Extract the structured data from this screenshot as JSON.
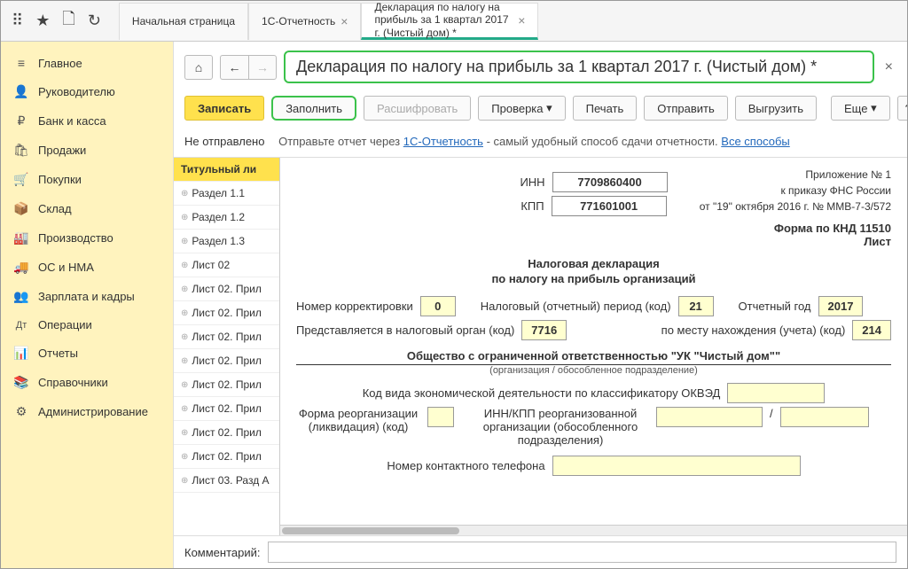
{
  "top_tabs": {
    "t1": "Начальная страница",
    "t2": "1С-Отчетность",
    "t3": "Декларация по налогу на прибыль за 1 квартал 2017 г. (Чистый дом) *"
  },
  "sidebar": {
    "items": [
      {
        "icon": "≡",
        "label": "Главное"
      },
      {
        "icon": "👤",
        "label": "Руководителю"
      },
      {
        "icon": "₽",
        "label": "Банк и касса"
      },
      {
        "icon": "🛍",
        "label": "Продажи"
      },
      {
        "icon": "🛒",
        "label": "Покупки"
      },
      {
        "icon": "📦",
        "label": "Склад"
      },
      {
        "icon": "🏭",
        "label": "Производство"
      },
      {
        "icon": "🚚",
        "label": "ОС и НМА"
      },
      {
        "icon": "👥",
        "label": "Зарплата и кадры"
      },
      {
        "icon": "Дт",
        "label": "Операции"
      },
      {
        "icon": "📊",
        "label": "Отчеты"
      },
      {
        "icon": "📚",
        "label": "Справочники"
      },
      {
        "icon": "⚙",
        "label": "Администрирование"
      }
    ]
  },
  "page_title": "Декларация по налогу на прибыль за 1 квартал 2017 г. (Чистый дом) *",
  "toolbar": {
    "save": "Записать",
    "fill": "Заполнить",
    "decode": "Расшифровать",
    "check": "Проверка",
    "print": "Печать",
    "send": "Отправить",
    "export": "Выгрузить",
    "more": "Еще",
    "help": "?"
  },
  "status": {
    "label": "Не отправлено",
    "text1": "Отправьте отчет через ",
    "link1": "1С-Отчетность",
    "text2": " - самый удобный способ сдачи отчетности. ",
    "link2": "Все способы"
  },
  "tree": [
    "Титульный ли",
    "Раздел 1.1",
    "Раздел 1.2",
    "Раздел 1.3",
    "Лист 02",
    "Лист 02. Прил",
    "Лист 02. Прил",
    "Лист 02. Прил",
    "Лист 02. Прил",
    "Лист 02. Прил",
    "Лист 02. Прил",
    "Лист 02. Прил",
    "Лист 02. Прил",
    "Лист 03. Разд А"
  ],
  "form": {
    "app_line1": "Приложение № 1",
    "app_line2": "к приказу ФНС России",
    "app_line3": "от \"19\" октября 2016 г. № ММВ-7-3/572",
    "inn_label": "ИНН",
    "inn": "7709860400",
    "kpp_label": "КПП",
    "kpp": "771601001",
    "knd": "Форма по КНД 11510",
    "sheet": "Лист",
    "title1": "Налоговая декларация",
    "title2": "по налогу на прибыль организаций",
    "corr_label": "Номер корректировки",
    "corr": "0",
    "period_label": "Налоговый (отчетный) период (код)",
    "period": "21",
    "year_label": "Отчетный год",
    "year": "2017",
    "organ_label": "Представляется в налоговый орган (код)",
    "organ": "7716",
    "place_label": "по месту нахождения (учета) (код)",
    "place": "214",
    "org_name": "Общество с ограниченной ответственностью \"УК \"Чистый дом\"\"",
    "org_sub": "(организация / обособленное подразделение)",
    "okved_label": "Код вида экономической деятельности по классификатору ОКВЭД",
    "reorg_label": "Форма реорганизации (ликвидация) (код)",
    "reorg_inn_label": "ИНН/КПП реорганизованной организации (обособленного подразделения)",
    "phone_label": "Номер контактного телефона",
    "slash": "/"
  },
  "comment_label": "Комментарий:"
}
